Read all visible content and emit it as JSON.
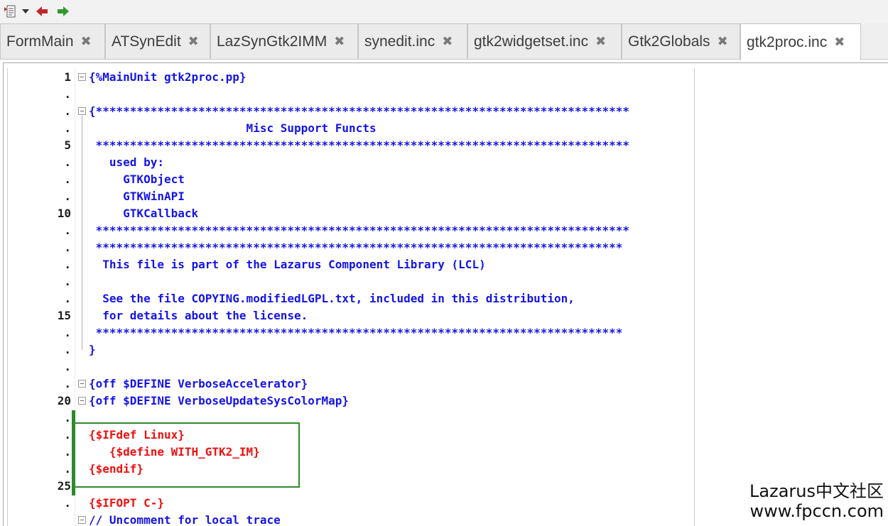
{
  "toolbar": {
    "icons": [
      "source-file-icon",
      "dropdown-arrow-icon",
      "back-arrow-icon",
      "forward-arrow-icon"
    ],
    "colors": {
      "back": "#c0282d",
      "forward": "#2e9a2e"
    }
  },
  "tabs": [
    {
      "label": "FormMain",
      "close": "✖"
    },
    {
      "label": "ATSynEdit",
      "close": "✖"
    },
    {
      "label": "LazSynGtk2IMM",
      "close": "✖"
    },
    {
      "label": "synedit.inc",
      "close": "✖"
    },
    {
      "label": "gtk2widgetset.inc",
      "close": "✖"
    },
    {
      "label": "Gtk2Globals",
      "close": "✖"
    },
    {
      "label": "gtk2proc.inc",
      "close": "✖",
      "active": true
    }
  ],
  "gutter": {
    "lines": [
      "1",
      ".",
      ".",
      ".",
      "5",
      ".",
      ".",
      ".",
      "10",
      ".",
      ".",
      ".",
      ".",
      "15",
      ".",
      ".",
      ".",
      ".",
      "20",
      ".",
      ".",
      ".",
      ".",
      "25",
      ".",
      "."
    ]
  },
  "code": {
    "lines": [
      "{%MainUnit gtk2proc.pp}",
      "",
      "{******************************************************************************",
      "                       Misc Support Functs",
      " ******************************************************************************",
      "   used by:",
      "     GTKObject",
      "     GTKWinAPI",
      "     GTKCallback",
      " ******************************************************************************",
      " *****************************************************************************",
      "  This file is part of the Lazarus Component Library (LCL)",
      "",
      "  See the file COPYING.modifiedLGPL.txt, included in this distribution,",
      "  for details about the license.",
      " *****************************************************************************",
      "}",
      "",
      "{off $DEFINE VerboseAccelerator}",
      "{off $DEFINE VerboseUpdateSysColorMap}",
      "",
      "{$IFdef Linux}",
      "   {$define WITH_GTK2_IM}",
      "{$endif}",
      "",
      "{$IFOPT C-}",
      "// Uncomment for local trace"
    ],
    "colors": {
      "comment": "#1414e6",
      "directive": "#f01010"
    }
  },
  "watermark": {
    "line1": "Lazarus中文社区",
    "line2": "www.fpccn.com"
  }
}
